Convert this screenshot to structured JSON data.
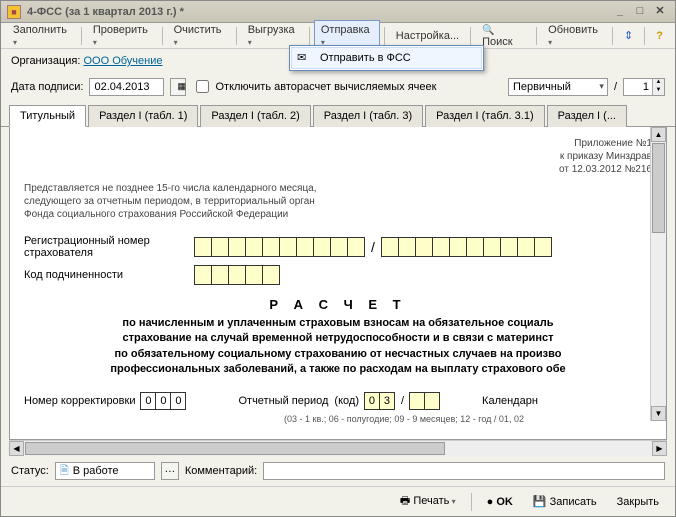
{
  "window": {
    "title": "4-ФСС (за 1 квартал 2013 г.) *"
  },
  "toolbar": {
    "fill": "Заполнить",
    "check": "Проверить",
    "clear": "Очистить",
    "export": "Выгрузка",
    "send": "Отправка",
    "settings": "Настройка...",
    "search": "Поиск",
    "refresh": "Обновить"
  },
  "dropdown": {
    "send_fss": "Отправить в ФСС"
  },
  "org": {
    "label": "Организация:",
    "value": "ООО Обучение"
  },
  "signdate": {
    "label": "Дата подписи:",
    "value": "02.04.2013",
    "checkbox": "Отключить авторасчет вычисляемых ячеек",
    "type_value": "Первичный",
    "slash": "/",
    "num": "1"
  },
  "tabs": {
    "t0": "Титульный",
    "t1": "Раздел I (табл. 1)",
    "t2": "Раздел I (табл. 2)",
    "t3": "Раздел I (табл. 3)",
    "t4": "Раздел I (табл. 3.1)",
    "t5": "Раздел I (..."
  },
  "form": {
    "annex1": "Приложение №1",
    "annex2": "к приказу Минздрав",
    "annex3": "от 12.03.2012 №216",
    "intro1": "Представляется не позднее 15-го числа календарного месяца,",
    "intro2": "следующего за отчетным периодом, в территориальный орган",
    "intro3": "Фонда социального страхования Российской Федерации",
    "reg_label1": "Регистрационный номер",
    "reg_label2": "страхователя",
    "sub_label": "Код подчиненности",
    "title": "Р А С Ч Е Т",
    "desc1": "по начисленным и уплаченным страховым взносам на обязательное социаль",
    "desc2": "страхование на случай временной нетрудоспособности и в связи с материнст",
    "desc3": "по обязательному социальному страхованию от несчастных случаев на произво",
    "desc4": "профессиональных заболеваний, а также по расходам на выплату страхового обе",
    "korr_label": "Номер корректировки",
    "korr_v1": "0",
    "korr_v2": "0",
    "korr_v3": "0",
    "period_label": "Отчетный период",
    "period_code": "(код)",
    "period_v1": "0",
    "period_v2": "3",
    "period_slash": "/",
    "calendar_label": "Календарн",
    "hint": "(03 - 1 кв.; 06 - полугодие; 09 - 9 месяцев; 12 - год / 01, 02"
  },
  "status": {
    "label": "Статус:",
    "value": "В работе",
    "comment_label": "Комментарий:"
  },
  "bottom": {
    "print": "Печать",
    "ok": "OK",
    "save": "Записать",
    "close": "Закрыть"
  }
}
